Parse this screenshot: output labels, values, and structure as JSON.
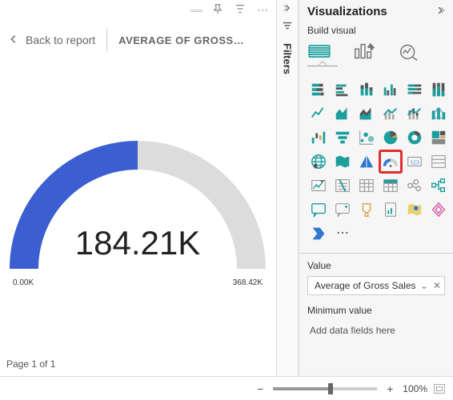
{
  "header": {
    "back_label": "Back to report",
    "title": "AVERAGE OF GROSS SAL..."
  },
  "chart_data": {
    "type": "gauge",
    "value": 184210,
    "value_display": "184.21K",
    "min": 0,
    "min_display": "0.00K",
    "max": 368420,
    "max_display": "368.42K",
    "fill_ratio": 0.5,
    "fill_color": "#3b5fd1",
    "track_color": "#dcdcdc"
  },
  "footer": {
    "page_label": "Page 1 of 1"
  },
  "filters": {
    "label": "Filters"
  },
  "viz_panel": {
    "title": "Visualizations",
    "build_label": "Build visual",
    "highlighted": "gauge-viz",
    "value_section_label": "Value",
    "value_field": "Average of Gross Sales",
    "min_section_label": "Minimum value",
    "min_placeholder": "Add data fields here"
  },
  "zoom": {
    "percent_label": "100%",
    "position": 0.55
  },
  "colors": {
    "accent": "#3b5fd1",
    "chip_teal": "#1b9e9e",
    "chip_gray": "#777",
    "chip_amber": "#d9a24a",
    "chip_pink": "#d85ea8"
  }
}
